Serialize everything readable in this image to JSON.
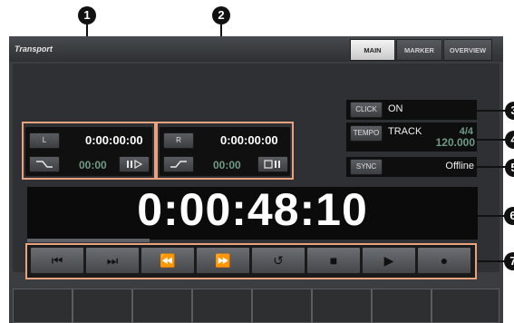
{
  "window": {
    "title": "Transport"
  },
  "tabs": [
    {
      "label": "MAIN",
      "active": true
    },
    {
      "label": "MARKER",
      "active": false
    },
    {
      "label": "OVERVIEW",
      "active": false
    }
  ],
  "callouts": [
    "1",
    "2",
    "3",
    "4",
    "5",
    "6",
    "7"
  ],
  "left_locator": {
    "button": "L",
    "time": "0:00:00:00",
    "sub_time": "00:00"
  },
  "right_locator": {
    "button": "R",
    "time": "0:00:00:00",
    "sub_time": "00:00"
  },
  "click": {
    "button": "CLICK",
    "value": "ON"
  },
  "tempo": {
    "button": "TEMPO",
    "track": "TRACK",
    "signature": "4/4",
    "bpm": "120.000"
  },
  "sync": {
    "button": "SYNC",
    "status": "Offline"
  },
  "position": {
    "time": "0:00:48:10"
  },
  "transport_buttons": [
    {
      "name": "go-to-start",
      "icon": "⏮"
    },
    {
      "name": "go-to-end",
      "icon": "⏭"
    },
    {
      "name": "rewind",
      "icon": "⏪"
    },
    {
      "name": "fast-forward",
      "icon": "⏩"
    },
    {
      "name": "cycle",
      "icon": "↺"
    },
    {
      "name": "stop",
      "icon": "■"
    },
    {
      "name": "play",
      "icon": "▶"
    },
    {
      "name": "record",
      "icon": "●"
    }
  ],
  "colors": {
    "accent_outline": "#e9a27f",
    "panel": "#3b3d40",
    "display": "#0b0b0b"
  }
}
